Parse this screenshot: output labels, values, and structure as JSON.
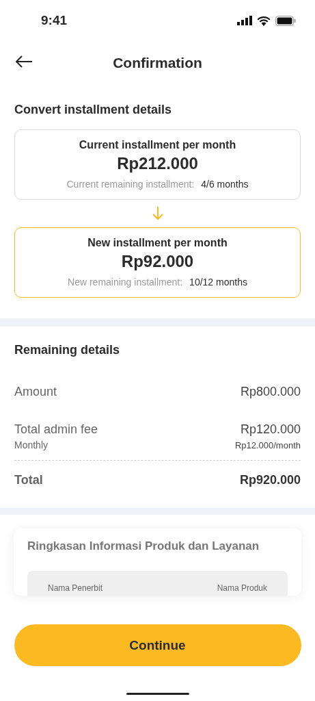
{
  "status_bar": {
    "time": "9:41"
  },
  "header": {
    "title": "Confirmation"
  },
  "convert": {
    "title": "Convert installment details",
    "cards": [
      {
        "title": "Current installment per month",
        "amount": "Rp212.000",
        "label": "Current remaining installment:",
        "value": "4/6 months",
        "highlighted": false
      },
      {
        "title": "New installment per month",
        "amount": "Rp92.000",
        "label": "New remaining installment:",
        "value": "10/12 months",
        "highlighted": true
      }
    ]
  },
  "remaining": {
    "title": "Remaining details",
    "rows": [
      {
        "label": "Amount",
        "value": "Rp800.000"
      },
      {
        "label": "Total admin fee",
        "value": "Rp120.000",
        "sublabel": "Monthly",
        "subvalue": "Rp12.000/month"
      }
    ],
    "total": {
      "label": "Total",
      "value": "Rp920.000"
    }
  },
  "summary": {
    "title": "Ringkasan Informasi Produk dan Layanan",
    "column_1": "Nama Penerbit",
    "column_2": "Nama Produk"
  },
  "footer": {
    "button": "Continue"
  }
}
